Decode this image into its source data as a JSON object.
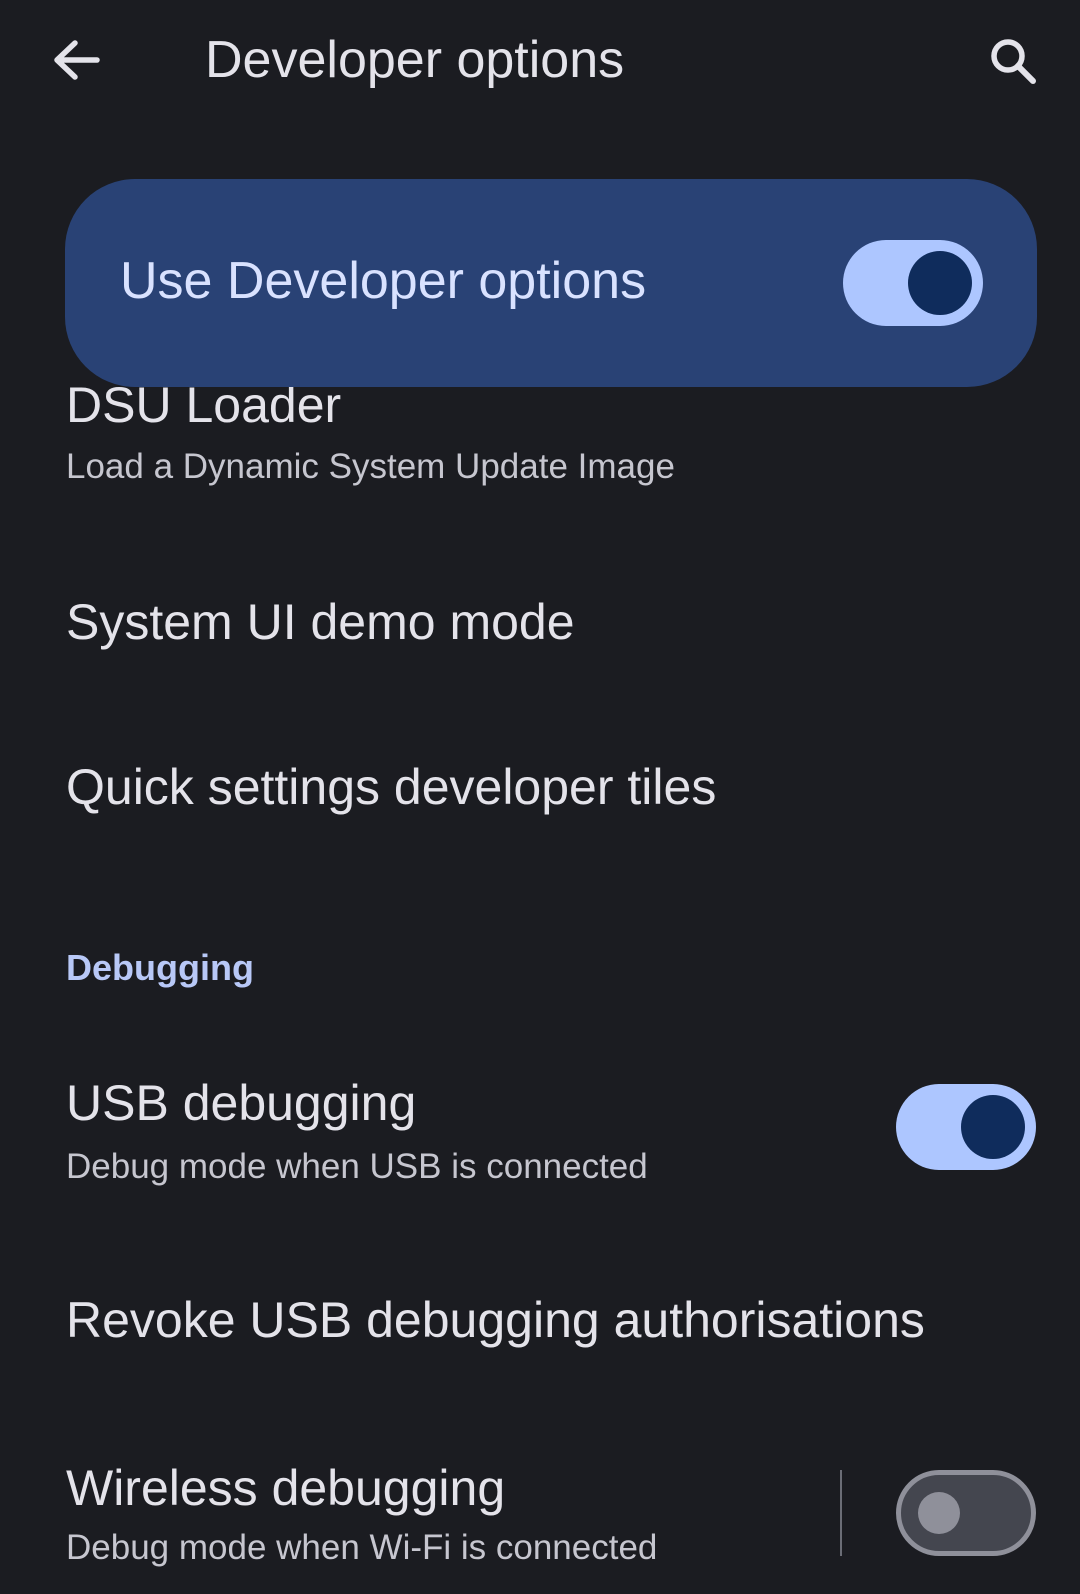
{
  "header": {
    "title": "Developer options",
    "back_icon": "arrow-back-icon",
    "search_icon": "search-icon"
  },
  "master": {
    "label": "Use Developer options",
    "enabled": true
  },
  "items": {
    "dsu": {
      "title": "DSU Loader",
      "subtitle": "Load a Dynamic System Update Image"
    },
    "demo_mode": {
      "title": "System UI demo mode"
    },
    "qs_tiles": {
      "title": "Quick settings developer tiles"
    }
  },
  "debugging": {
    "header": "Debugging",
    "usb": {
      "title": "USB debugging",
      "subtitle": "Debug mode when USB is connected",
      "enabled": true
    },
    "revoke": {
      "title": "Revoke USB debugging authorisations"
    },
    "wireless": {
      "title": "Wireless debugging",
      "subtitle": "Debug mode when Wi-Fi is connected",
      "enabled": false
    }
  },
  "colors": {
    "background": "#1b1c21",
    "card": "#294275",
    "accent": "#adc6ff",
    "section_header": "#b8c8f7"
  }
}
